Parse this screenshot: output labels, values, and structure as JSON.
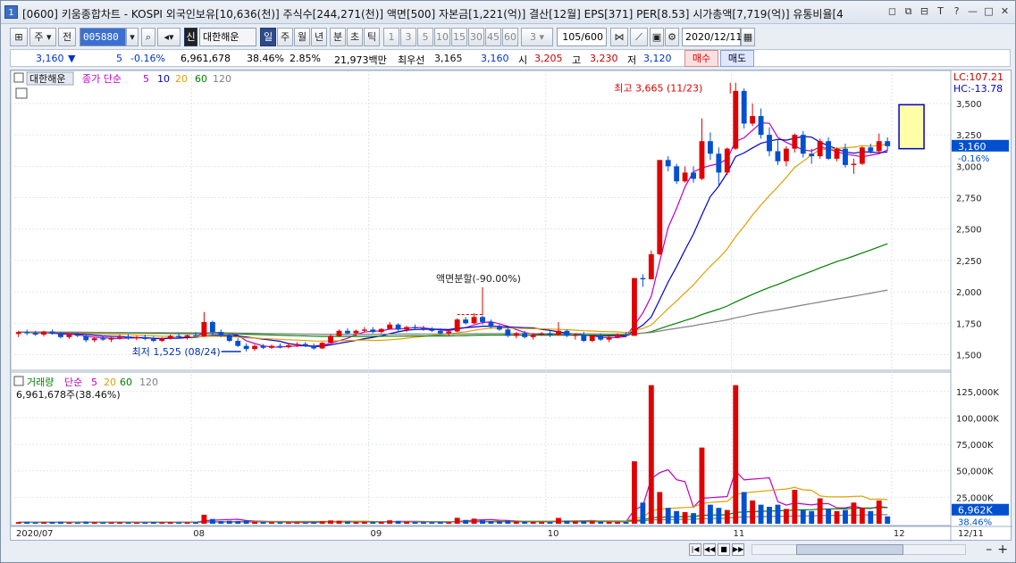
{
  "title": {
    "num": "1",
    "text": "[0600] 키움종합차트 - KOSPI 외국인보유[10,636(천)] 주식수[244,271(천)] 액면[500] 자본금[1,221(억)] 결산[12월] EPS[371] PER[8.53] 시가총액[7,719(억)] 유통비율[4"
  },
  "window_icons": [
    "◻",
    "⧉",
    "⊟",
    "T",
    "?",
    "—",
    "□",
    "✕"
  ],
  "toolbar": {
    "type_select": "주",
    "prev_label": "전",
    "code": "005880",
    "stock_badge": "신",
    "stock_name": "대한해운",
    "periods": [
      "일",
      "주",
      "월",
      "년",
      "분",
      "초",
      "틱"
    ],
    "active_period": "일",
    "minutes": [
      "1",
      "3",
      "5",
      "10",
      "15",
      "30",
      "45",
      "60"
    ],
    "minute_select": "3",
    "count": "105/600",
    "date": "2020/12/11"
  },
  "quote": {
    "price": "3,160",
    "arrow": "▼",
    "change": "5",
    "change_pct": "-0.16%",
    "volume": "6,961,678",
    "vol_ratio": "38.46%",
    "turnover": "2.85%",
    "amount": "21,973백만",
    "best_label": "최우선",
    "ask": "3,165",
    "bid": "3,160",
    "open_label": "시",
    "open": "3,205",
    "high_label": "고",
    "high": "3,230",
    "low_label": "저",
    "low": "3,120",
    "buy_label": "매수",
    "sell_label": "매도"
  },
  "price_panel": {
    "name_tag": "대한해운",
    "legend_prefix": "종가 단순",
    "ma": [
      {
        "label": "5",
        "color": "#c000c0"
      },
      {
        "label": "10",
        "color": "#0000cc"
      },
      {
        "label": "20",
        "color": "#e0a000"
      },
      {
        "label": "60",
        "color": "#008000"
      },
      {
        "label": "120",
        "color": "#808080"
      }
    ],
    "lc": "LC:107.21",
    "hc": "HC:-13.78",
    "y_ticks": [
      "3,500",
      "3,250",
      "3,000",
      "2,750",
      "2,500",
      "2,250",
      "2,000",
      "1,750",
      "1,500"
    ],
    "y_values": [
      3500,
      3250,
      3000,
      2750,
      2500,
      2250,
      2000,
      1750,
      1500
    ],
    "current_price": "3,160",
    "current_pct": "-0.16%",
    "annot_high": "최고 3,665 (11/23)",
    "annot_low": "최저 1,525 (08/24)",
    "annot_split": "액면분할(-90.00%)"
  },
  "volume_panel": {
    "legend_prefix": "거래량",
    "legend_ma": "단순",
    "ma": [
      {
        "label": "5",
        "color": "#c000c0"
      },
      {
        "label": "20",
        "color": "#e0a000"
      },
      {
        "label": "60",
        "color": "#008000"
      },
      {
        "label": "120",
        "color": "#808080"
      }
    ],
    "sub": "6,961,678주(38.46%)",
    "y_ticks": [
      "125,000K",
      "100,000K",
      "75,000K",
      "50,000K",
      "25,000K"
    ],
    "y_values": [
      125000,
      100000,
      75000,
      50000,
      25000
    ],
    "current": "6,962K",
    "current_pct": "38.46%"
  },
  "x_axis": [
    "2020/07",
    "08",
    "09",
    "10",
    "11",
    "12",
    "12/11"
  ],
  "chart_data": {
    "type": "candlestick",
    "price_range": [
      1390,
      3720
    ],
    "volume_range": [
      0,
      140000
    ],
    "candles": [
      [
        1665,
        1690,
        1640,
        1680,
        1500
      ],
      [
        1680,
        1700,
        1655,
        1670,
        1800
      ],
      [
        1670,
        1690,
        1650,
        1660,
        1200
      ],
      [
        1660,
        1690,
        1645,
        1685,
        1400
      ],
      [
        1685,
        1700,
        1660,
        1665,
        1600
      ],
      [
        1665,
        1680,
        1630,
        1640,
        1900
      ],
      [
        1640,
        1670,
        1625,
        1660,
        1300
      ],
      [
        1660,
        1675,
        1640,
        1650,
        1100
      ],
      [
        1650,
        1665,
        1600,
        1615,
        2100
      ],
      [
        1615,
        1640,
        1600,
        1630,
        1500
      ],
      [
        1630,
        1650,
        1610,
        1620,
        1200
      ],
      [
        1620,
        1640,
        1600,
        1635,
        1300
      ],
      [
        1635,
        1660,
        1620,
        1645,
        1400
      ],
      [
        1645,
        1665,
        1620,
        1630,
        1200
      ],
      [
        1630,
        1650,
        1615,
        1640,
        1100
      ],
      [
        1640,
        1660,
        1615,
        1625,
        1300
      ],
      [
        1625,
        1645,
        1600,
        1610,
        1600
      ],
      [
        1610,
        1640,
        1600,
        1630,
        1400
      ],
      [
        1630,
        1660,
        1620,
        1650,
        1500
      ],
      [
        1650,
        1670,
        1630,
        1640,
        1200
      ],
      [
        1640,
        1660,
        1620,
        1655,
        1300
      ],
      [
        1655,
        1680,
        1640,
        1645,
        1400
      ],
      [
        1645,
        1840,
        1640,
        1760,
        8500
      ],
      [
        1760,
        1770,
        1660,
        1680,
        4500
      ],
      [
        1680,
        1700,
        1640,
        1650,
        2500
      ],
      [
        1650,
        1665,
        1600,
        1610,
        2800
      ],
      [
        1610,
        1630,
        1560,
        1570,
        2600
      ],
      [
        1570,
        1590,
        1525,
        1545,
        2900
      ],
      [
        1545,
        1580,
        1530,
        1570,
        1800
      ],
      [
        1570,
        1585,
        1545,
        1555,
        1500
      ],
      [
        1555,
        1580,
        1545,
        1570,
        1400
      ],
      [
        1570,
        1590,
        1550,
        1560,
        1300
      ],
      [
        1560,
        1585,
        1550,
        1575,
        1200
      ],
      [
        1575,
        1600,
        1560,
        1585,
        1300
      ],
      [
        1585,
        1600,
        1560,
        1570,
        1200
      ],
      [
        1570,
        1590,
        1540,
        1550,
        1500
      ],
      [
        1550,
        1600,
        1545,
        1595,
        2200
      ],
      [
        1595,
        1660,
        1590,
        1650,
        3100
      ],
      [
        1650,
        1700,
        1640,
        1690,
        2800
      ],
      [
        1690,
        1710,
        1660,
        1670,
        2000
      ],
      [
        1670,
        1700,
        1650,
        1690,
        1600
      ],
      [
        1690,
        1720,
        1680,
        1700,
        1800
      ],
      [
        1700,
        1720,
        1670,
        1680,
        1500
      ],
      [
        1680,
        1710,
        1670,
        1705,
        1700
      ],
      [
        1705,
        1760,
        1700,
        1740,
        3200
      ],
      [
        1740,
        1750,
        1690,
        1700,
        2600
      ],
      [
        1700,
        1730,
        1680,
        1720,
        1900
      ],
      [
        1720,
        1740,
        1700,
        1710,
        1500
      ],
      [
        1710,
        1730,
        1690,
        1700,
        1400
      ],
      [
        1700,
        1720,
        1680,
        1690,
        1300
      ],
      [
        1690,
        1710,
        1660,
        1670,
        1500
      ],
      [
        1670,
        1690,
        1650,
        1685,
        1400
      ],
      [
        1685,
        1790,
        1680,
        1780,
        5600
      ],
      [
        1780,
        1800,
        1740,
        1750,
        3600
      ],
      [
        1750,
        1830,
        1745,
        1800,
        4800
      ],
      [
        1800,
        1810,
        1740,
        1760,
        3200
      ],
      [
        1760,
        1780,
        1710,
        1720,
        2500
      ],
      [
        1720,
        1740,
        1690,
        1700,
        2300
      ],
      [
        1700,
        1720,
        1640,
        1650,
        2800
      ],
      [
        1650,
        1680,
        1630,
        1670,
        2100
      ],
      [
        1670,
        1690,
        1630,
        1640,
        1900
      ],
      [
        1640,
        1670,
        1620,
        1660,
        1700
      ],
      [
        1660,
        1680,
        1650,
        1670,
        1500
      ],
      [
        1670,
        1690,
        1640,
        1660,
        1400
      ],
      [
        1660,
        1760,
        1650,
        1690,
        5500
      ],
      [
        1690,
        1700,
        1640,
        1650,
        2600
      ],
      [
        1650,
        1670,
        1620,
        1660,
        2200
      ],
      [
        1660,
        1680,
        1600,
        1610,
        2400
      ],
      [
        1610,
        1660,
        1600,
        1650,
        2300
      ],
      [
        1650,
        1670,
        1610,
        1620,
        2000
      ],
      [
        1620,
        1650,
        1600,
        1640,
        1800
      ],
      [
        1640,
        1670,
        1630,
        1660,
        1700
      ],
      [
        1660,
        1680,
        1640,
        1650,
        1600
      ],
      [
        1650,
        2110,
        1650,
        2110,
        59000
      ],
      [
        2110,
        2140,
        2040,
        2100,
        20000
      ],
      [
        2100,
        2330,
        2100,
        2300,
        131000
      ],
      [
        2300,
        3050,
        2290,
        3050,
        30000
      ],
      [
        3050,
        3080,
        2960,
        3000,
        15000
      ],
      [
        3000,
        3020,
        2860,
        2880,
        12000
      ],
      [
        2880,
        3000,
        2870,
        2950,
        11000
      ],
      [
        2950,
        3000,
        2870,
        2900,
        10000
      ],
      [
        2900,
        3380,
        2890,
        3200,
        72000
      ],
      [
        3200,
        3270,
        3050,
        3100,
        18000
      ],
      [
        3100,
        3150,
        2850,
        2950,
        15000
      ],
      [
        2950,
        3150,
        2930,
        3140,
        13000
      ],
      [
        3140,
        3665,
        3130,
        3600,
        131000
      ],
      [
        3600,
        3620,
        3300,
        3340,
        30000
      ],
      [
        3340,
        3500,
        3320,
        3400,
        22000
      ],
      [
        3400,
        3460,
        3220,
        3250,
        18000
      ],
      [
        3250,
        3310,
        3080,
        3120,
        16000
      ],
      [
        3120,
        3210,
        3010,
        3040,
        18000
      ],
      [
        3040,
        3160,
        3000,
        3140,
        14000
      ],
      [
        3140,
        3260,
        3110,
        3250,
        32000
      ],
      [
        3250,
        3280,
        3070,
        3100,
        13000
      ],
      [
        3100,
        3140,
        3020,
        3080,
        12000
      ],
      [
        3080,
        3220,
        3060,
        3200,
        24000
      ],
      [
        3200,
        3230,
        3050,
        3060,
        14000
      ],
      [
        3060,
        3150,
        3040,
        3140,
        12000
      ],
      [
        3140,
        3180,
        2990,
        3010,
        13000
      ],
      [
        3010,
        3060,
        2940,
        3020,
        20000
      ],
      [
        3020,
        3160,
        3010,
        3150,
        15000
      ],
      [
        3150,
        3180,
        3100,
        3120,
        12000
      ],
      [
        3120,
        3260,
        3110,
        3200,
        22000
      ],
      [
        3200,
        3230,
        3120,
        3160,
        6962
      ]
    ]
  }
}
